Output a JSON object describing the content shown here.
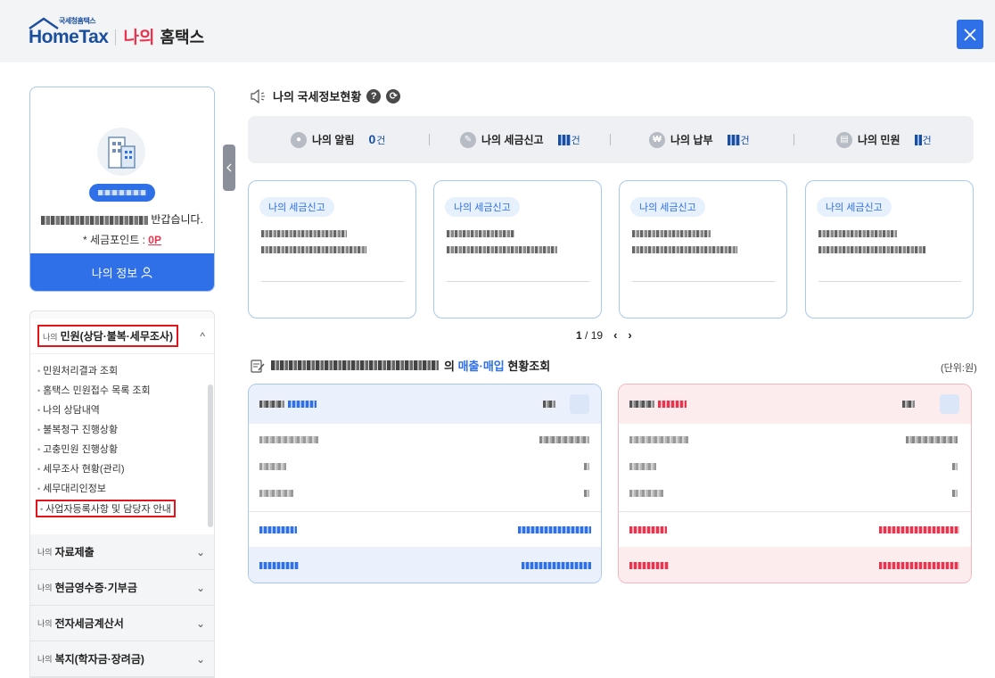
{
  "header": {
    "logo_small": "국세청홈택스",
    "logo_main": "HomeTax",
    "logo_my": "나의",
    "logo_title": "홈택스",
    "close_icon": "close-icon"
  },
  "profile": {
    "greeting_suffix": "반갑습니다.",
    "points_label": "* 세금포인트 : ",
    "points_value": "0P",
    "myinfo_label": "나의 정보"
  },
  "menu": {
    "open_section": {
      "prefix": "나의",
      "label": "민원(상담·불복·세무조사)",
      "items": [
        "민원처리결과 조회",
        "홈택스 민원접수 목록 조회",
        "나의 상담내역",
        "불복청구 진행상황",
        "고충민원 진행상황",
        "세무조사 현황(관리)",
        "세무대리인정보",
        "사업자등록사항 및 담당자 안내"
      ]
    },
    "sections": [
      {
        "prefix": "나의",
        "label": "자료제출"
      },
      {
        "prefix": "나의",
        "label": "현금영수증·기부금"
      },
      {
        "prefix": "나의",
        "label": "전자세금계산서"
      },
      {
        "prefix": "나의",
        "label": "복지(학자금·장려금)"
      }
    ]
  },
  "status": {
    "title": "나의 국세정보현황",
    "items": [
      {
        "label": "나의 알림",
        "count": "0",
        "unit": "건"
      },
      {
        "label": "나의 세금신고",
        "count": "",
        "unit": "건"
      },
      {
        "label": "나의 납부",
        "count": "",
        "unit": "건"
      },
      {
        "label": "나의 민원",
        "count": "",
        "unit": "건"
      }
    ]
  },
  "cards": [
    {
      "tag": "나의 세금신고"
    },
    {
      "tag": "나의 세금신고"
    },
    {
      "tag": "나의 세금신고"
    },
    {
      "tag": "나의 세금신고"
    }
  ],
  "pager": {
    "current": "1",
    "total": "19",
    "prev": "‹",
    "next": "›"
  },
  "sales": {
    "title_mid": "의 ",
    "title_highlight": "매출·매입",
    "title_tail": " 현황조회",
    "unit": "(단위:원)"
  },
  "colors": {
    "accent": "#2f6fe8",
    "brand": "#1a4fa0",
    "red": "#e8344e"
  }
}
